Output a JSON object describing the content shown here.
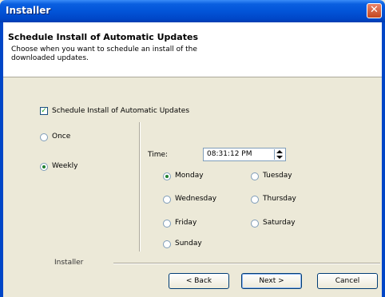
{
  "window": {
    "title": "Installer",
    "close_glyph": "✕"
  },
  "header": {
    "title": "Schedule Install of Automatic Updates",
    "subtitle": "Choose when you want to schedule an install of the downloaded updates."
  },
  "schedule_checkbox": {
    "label": "Schedule Install of Automatic Updates",
    "checked": true,
    "mark": "✓"
  },
  "frequency": {
    "options": [
      {
        "label": "Once",
        "selected": false
      },
      {
        "label": "Weekly",
        "selected": true
      }
    ]
  },
  "time": {
    "label": "Time:",
    "value": "08:31:12 PM"
  },
  "days": [
    {
      "label": "Monday",
      "selected": true
    },
    {
      "label": "Tuesday",
      "selected": false
    },
    {
      "label": "Wednesday",
      "selected": false
    },
    {
      "label": "Thursday",
      "selected": false
    },
    {
      "label": "Friday",
      "selected": false
    },
    {
      "label": "Saturday",
      "selected": false
    },
    {
      "label": "Sunday",
      "selected": false
    }
  ],
  "footer": {
    "brand": "Installer"
  },
  "buttons": {
    "back": "< Back",
    "next": "Next >",
    "cancel": "Cancel"
  }
}
